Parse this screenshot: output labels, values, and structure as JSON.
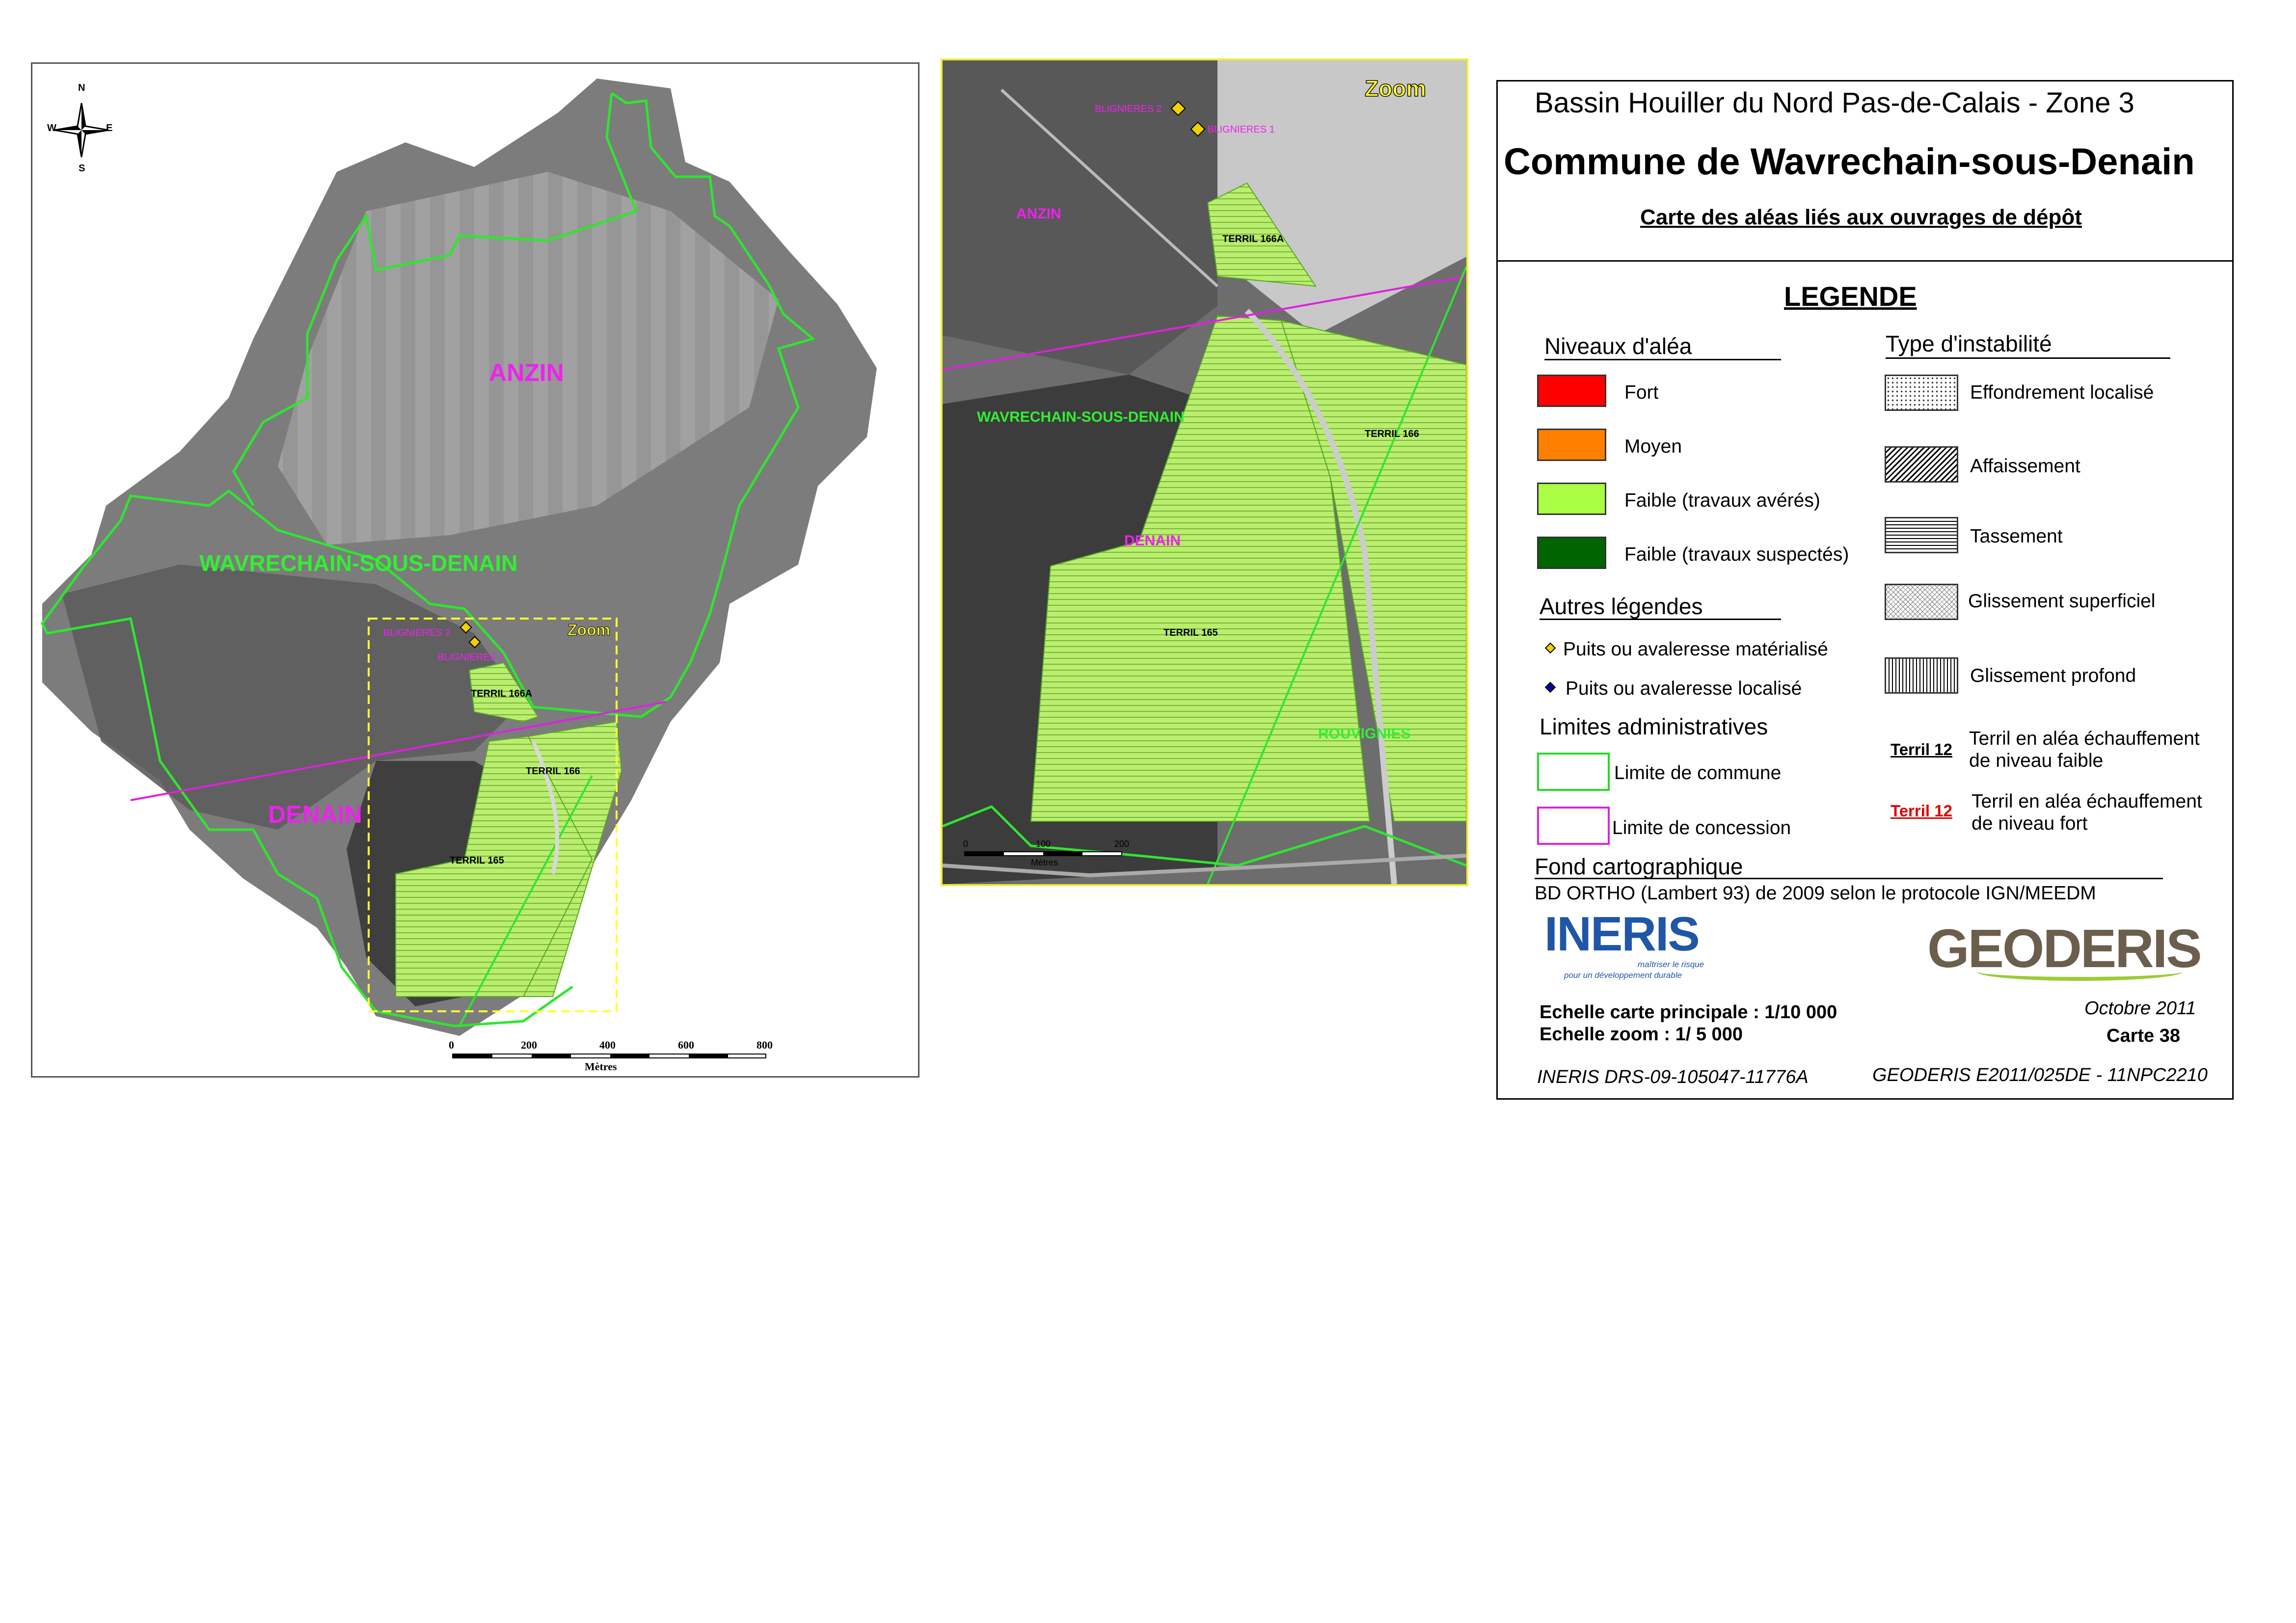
{
  "main_map": {
    "labels": {
      "anzin": "ANZIN",
      "wavrechain": "WAVRECHAIN-SOUS-DENAIN",
      "denain": "DENAIN",
      "terril_166a": "TERRIL 166A",
      "terril_166": "TERRIL 166",
      "terril_165": "TERRIL 165",
      "blignieres_2": "BLIGNIERES 2",
      "blignieres_1": "BLIGNIERES 1",
      "zoom": "Zoom"
    },
    "compass": {
      "n": "N",
      "s": "S",
      "e": "E",
      "w": "W"
    },
    "scale": {
      "ticks": [
        "0",
        "200",
        "400",
        "600",
        "800"
      ],
      "unit": "Mètres"
    }
  },
  "zoom_map": {
    "labels": {
      "zoom": "Zoom",
      "blignieres_2": "BLIGNIERES 2",
      "blignieres_1": "BLIGNIERES 1",
      "anzin": "ANZIN",
      "terril_166a": "TERRIL 166A",
      "wavrechain": "WAVRECHAIN-SOUS-DENAIN",
      "terril_166": "TERRIL 166",
      "denain": "DENAIN",
      "terril_165": "TERRIL 165",
      "rouvignies": "ROUVIGNIES"
    },
    "scale": {
      "ticks": [
        "0",
        "100",
        "200"
      ],
      "unit": "Mètres"
    }
  },
  "header": {
    "subtitle": "Bassin Houiller du Nord Pas-de-Calais - Zone 3",
    "title": "Commune de Wavrechain-sous-Denain",
    "map_title": "Carte des aléas liés aux ouvrages de dépôt"
  },
  "legend": {
    "title": "LEGENDE",
    "hazard_heading": "Niveaux d'aléa",
    "hazard_items": [
      {
        "label": "Fort",
        "color": "#ff0000"
      },
      {
        "label": "Moyen",
        "color": "#ff8000"
      },
      {
        "label": "Faible (travaux avérés)",
        "color": "#aaff44"
      },
      {
        "label": "Faible (travaux suspectés)",
        "color": "#006400"
      }
    ],
    "other_heading": "Autres légendes",
    "other_items": [
      {
        "label": "Puits ou avaleresse matérialisé",
        "color": "#f0d000"
      },
      {
        "label": "Puits ou avaleresse localisé",
        "color": "#0000a0"
      }
    ],
    "admin_heading": "Limites administratives",
    "admin_items": [
      {
        "label": "Limite de commune",
        "color": "#22dd22"
      },
      {
        "label": "Limite de concession",
        "color": "#dd22dd"
      }
    ],
    "instability_heading": "Type d'instabilité",
    "instability_items": [
      {
        "label": "Effondrement  localisé",
        "pattern": "dots"
      },
      {
        "label": "Affaissement",
        "pattern": "diagonal"
      },
      {
        "label": "Tassement",
        "pattern": "horizontal"
      },
      {
        "label": "Glissement superficiel",
        "pattern": "crosshatch"
      },
      {
        "label": "Glissement profond",
        "pattern": "vertical"
      }
    ],
    "terril_items": [
      {
        "tag": "Terril 12",
        "tag_color": "#000000",
        "line1": "Terril en aléa échauffement",
        "line2": "de niveau faible"
      },
      {
        "tag": "Terril 12",
        "tag_color": "#dd0000",
        "line1": "Terril en aléa échauffement",
        "line2": "de niveau fort"
      }
    ]
  },
  "footer": {
    "fond_heading": "Fond cartographique",
    "fond_text": "BD ORTHO (Lambert 93) de 2009 selon le protocole IGN/MEEDM",
    "ineris_logo": "INERIS",
    "ineris_tagline_1": "maîtriser le risque",
    "ineris_tagline_2": "pour un développement durable",
    "geoderis_logo": "GEODERIS",
    "scale_main": "Echelle carte principale : 1/10 000",
    "scale_zoom": "Echelle zoom : 1/ 5 000",
    "date": "Octobre 2011",
    "carte": "Carte  38",
    "ref_ineris": "INERIS DRS-09-105047-11776A",
    "ref_geoderis": "GEODERIS E2011/025DE - 11NPC2210"
  }
}
